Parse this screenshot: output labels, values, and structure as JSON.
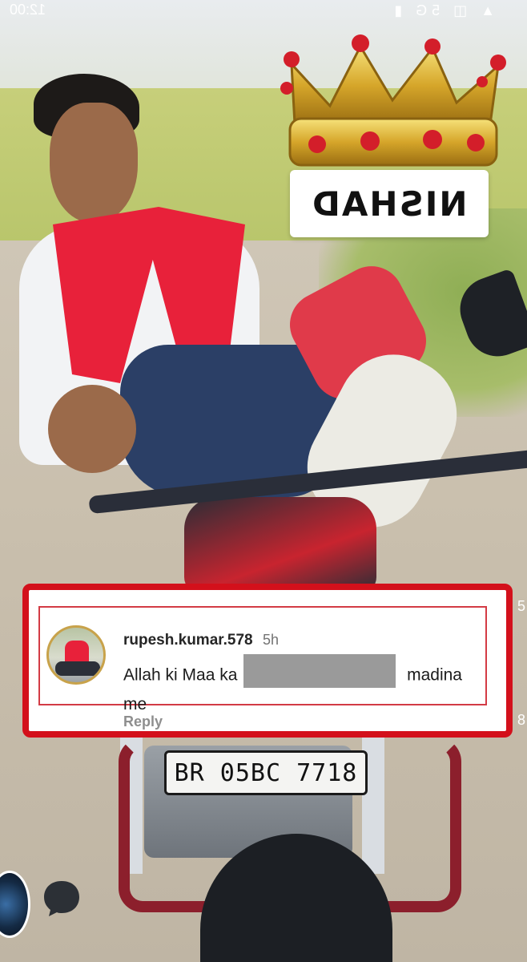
{
  "status_bar": {
    "time": "12:00",
    "icons": "▲ ◫ 5G ▮"
  },
  "sticker": {
    "name_text": "NISHAD"
  },
  "bike": {
    "plate": "BR 05BC 7718"
  },
  "comment": {
    "username": "rupesh.kumar.578",
    "time": "5h",
    "text_before": "Allah ki Maa ka",
    "text_after": "madina me",
    "reply_label": "Reply"
  },
  "side_markers": [
    "5",
    "8"
  ],
  "icons": {
    "music": "music-disc-icon",
    "comment": "speech-bubble-icon",
    "avatar": "user-avatar"
  },
  "colors": {
    "highlight_border": "#d3101b",
    "inner_border": "#d33b45",
    "redaction": "#9a9a9a"
  }
}
